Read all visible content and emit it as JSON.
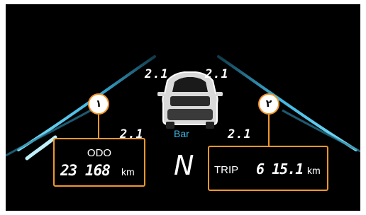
{
  "tire_pressure": {
    "rear_left": "2.1",
    "rear_right": "2.1",
    "front_left": "2.1",
    "front_right": "2.1",
    "unit": "Bar"
  },
  "callouts": {
    "left": "١",
    "right": "٢"
  },
  "odometer": {
    "title": "ODO",
    "value": "23 168",
    "unit": "km"
  },
  "trip": {
    "label": "TRIP",
    "value": "6 15.1",
    "unit": "km"
  },
  "gear": "N",
  "colors": {
    "screen_background": "#000000",
    "lane_cyan": "#3fb6e2",
    "callout_orange": "#f0972c",
    "text": "#ffffff"
  }
}
